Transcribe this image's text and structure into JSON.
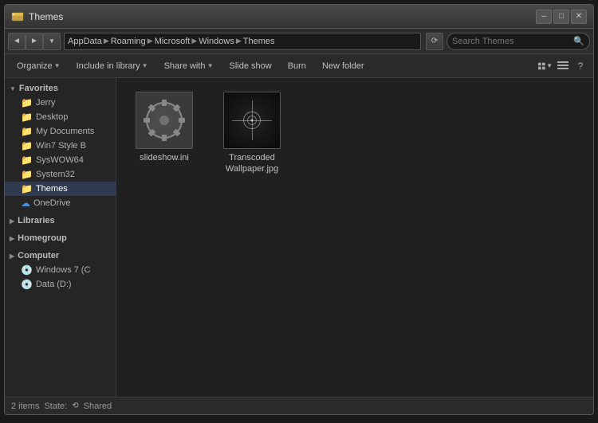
{
  "window": {
    "title": "Themes",
    "title_icon": "folder",
    "controls": {
      "minimize": "–",
      "maximize": "□",
      "close": "✕"
    }
  },
  "address_bar": {
    "back": "◄",
    "forward": "►",
    "up": "▲",
    "recent": "▼",
    "path_segments": [
      "AppData",
      "Roaming",
      "Microsoft",
      "Windows",
      "Themes"
    ],
    "search_placeholder": "Search Themes"
  },
  "toolbar": {
    "organize": "Organize",
    "include_library": "Include in library",
    "share_with": "Share with",
    "slide_show": "Slide show",
    "burn": "Burn",
    "new_folder": "New folder"
  },
  "sidebar": {
    "favorites": {
      "header": "Favorites",
      "items": [
        {
          "label": "Jerry",
          "icon": "folder"
        },
        {
          "label": "Desktop",
          "icon": "folder"
        },
        {
          "label": "My Documents",
          "icon": "folder"
        },
        {
          "label": "Win7 Style B",
          "icon": "folder"
        },
        {
          "label": "SysWOW64",
          "icon": "folder"
        },
        {
          "label": "System32",
          "icon": "folder"
        },
        {
          "label": "Themes",
          "icon": "folder",
          "selected": true
        },
        {
          "label": "OneDrive",
          "icon": "onedrive"
        }
      ]
    },
    "libraries": {
      "header": "Libraries"
    },
    "homegroup": {
      "header": "Homegroup"
    },
    "computer": {
      "header": "Computer",
      "items": [
        {
          "label": "Windows 7 (C",
          "icon": "drive"
        },
        {
          "label": "Data (D:)",
          "icon": "drive"
        }
      ]
    }
  },
  "files": [
    {
      "name": "slideshow.ini",
      "type": "ini"
    },
    {
      "name": "Transcoded Wallpaper.jpg",
      "type": "jpg"
    }
  ],
  "status_bar": {
    "item_count": "2 items",
    "state_label": "State:",
    "state_value": "Shared"
  }
}
